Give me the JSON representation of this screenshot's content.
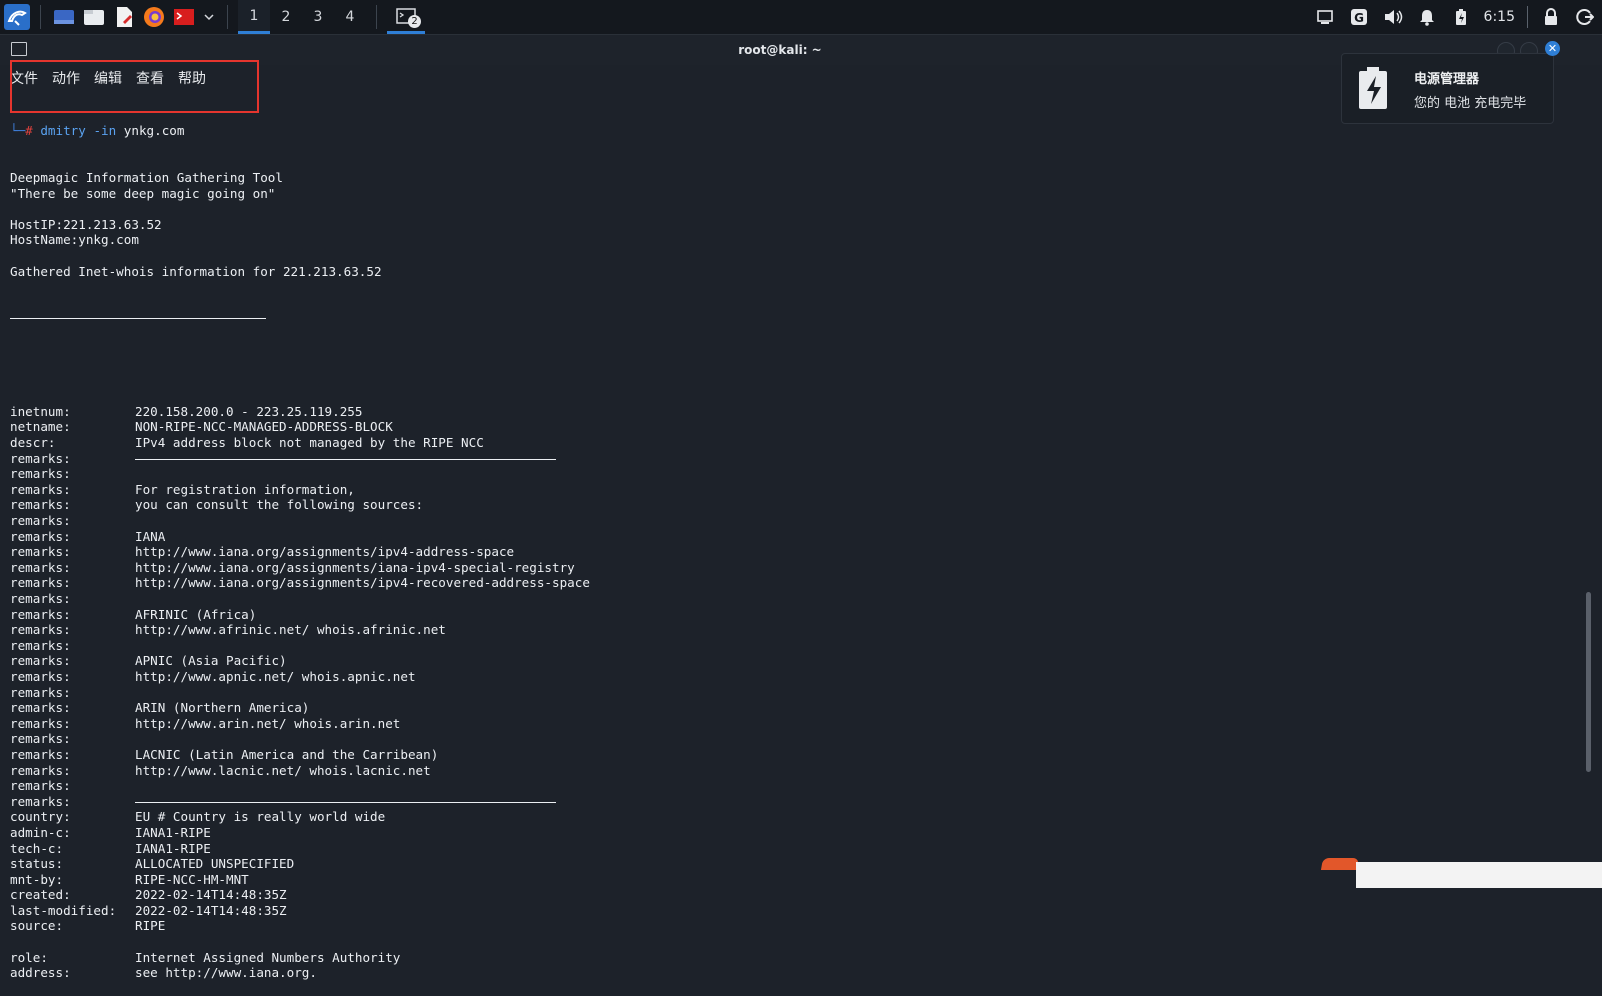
{
  "panel": {
    "workspaces": [
      "1",
      "2",
      "3",
      "4"
    ],
    "active_workspace": "1",
    "task_count": "2",
    "clock": "6:15"
  },
  "window": {
    "title": "root@kali: ~"
  },
  "menu": [
    "文件",
    "动作",
    "编辑",
    "查看",
    "帮助"
  ],
  "prompt": {
    "command": "dmitry",
    "args": "-in",
    "target": "ynkg.com"
  },
  "header_lines": [
    "Deepmagic Information Gathering Tool",
    "\"There be some deep magic going on\"",
    "",
    "HostIP:221.213.63.52",
    "HostName:ynkg.com",
    "",
    "Gathered Inet-whois information for 221.213.63.52"
  ],
  "whois": [
    {
      "k": "",
      "v": ""
    },
    {
      "k": "",
      "v": ""
    },
    {
      "k": "",
      "v": ""
    },
    {
      "k": "inetnum:",
      "v": "220.158.200.0 - 223.25.119.255"
    },
    {
      "k": "netname:",
      "v": "NON-RIPE-NCC-MANAGED-ADDRESS-BLOCK"
    },
    {
      "k": "descr:",
      "v": "IPv4 address block not managed by the RIPE NCC"
    },
    {
      "k": "remarks:",
      "v": "",
      "rule": true
    },
    {
      "k": "remarks:",
      "v": ""
    },
    {
      "k": "remarks:",
      "v": "For registration information,"
    },
    {
      "k": "remarks:",
      "v": "you can consult the following sources:"
    },
    {
      "k": "remarks:",
      "v": ""
    },
    {
      "k": "remarks:",
      "v": "IANA"
    },
    {
      "k": "remarks:",
      "v": "http://www.iana.org/assignments/ipv4-address-space"
    },
    {
      "k": "remarks:",
      "v": "http://www.iana.org/assignments/iana-ipv4-special-registry"
    },
    {
      "k": "remarks:",
      "v": "http://www.iana.org/assignments/ipv4-recovered-address-space"
    },
    {
      "k": "remarks:",
      "v": ""
    },
    {
      "k": "remarks:",
      "v": "AFRINIC (Africa)"
    },
    {
      "k": "remarks:",
      "v": "http://www.afrinic.net/ whois.afrinic.net"
    },
    {
      "k": "remarks:",
      "v": ""
    },
    {
      "k": "remarks:",
      "v": "APNIC (Asia Pacific)"
    },
    {
      "k": "remarks:",
      "v": "http://www.apnic.net/ whois.apnic.net"
    },
    {
      "k": "remarks:",
      "v": ""
    },
    {
      "k": "remarks:",
      "v": "ARIN (Northern America)"
    },
    {
      "k": "remarks:",
      "v": "http://www.arin.net/ whois.arin.net"
    },
    {
      "k": "remarks:",
      "v": ""
    },
    {
      "k": "remarks:",
      "v": "LACNIC (Latin America and the Carribean)"
    },
    {
      "k": "remarks:",
      "v": "http://www.lacnic.net/ whois.lacnic.net"
    },
    {
      "k": "remarks:",
      "v": ""
    },
    {
      "k": "remarks:",
      "v": "",
      "rule": true
    },
    {
      "k": "country:",
      "v": "EU # Country is really world wide"
    },
    {
      "k": "admin-c:",
      "v": "IANA1-RIPE"
    },
    {
      "k": "tech-c:",
      "v": "IANA1-RIPE"
    },
    {
      "k": "status:",
      "v": "ALLOCATED UNSPECIFIED"
    },
    {
      "k": "mnt-by:",
      "v": "RIPE-NCC-HM-MNT"
    },
    {
      "k": "created:",
      "v": "2022-02-14T14:48:35Z"
    },
    {
      "k": "last-modified:",
      "v": "2022-02-14T14:48:35Z"
    },
    {
      "k": "source:",
      "v": "RIPE"
    },
    {
      "k": "",
      "v": ""
    },
    {
      "k": "role:",
      "v": "Internet Assigned Numbers Authority"
    },
    {
      "k": "address:",
      "v": "see http://www.iana.org."
    }
  ],
  "notification": {
    "title": "电源管理器",
    "body": "您的 电池 充电完毕"
  }
}
